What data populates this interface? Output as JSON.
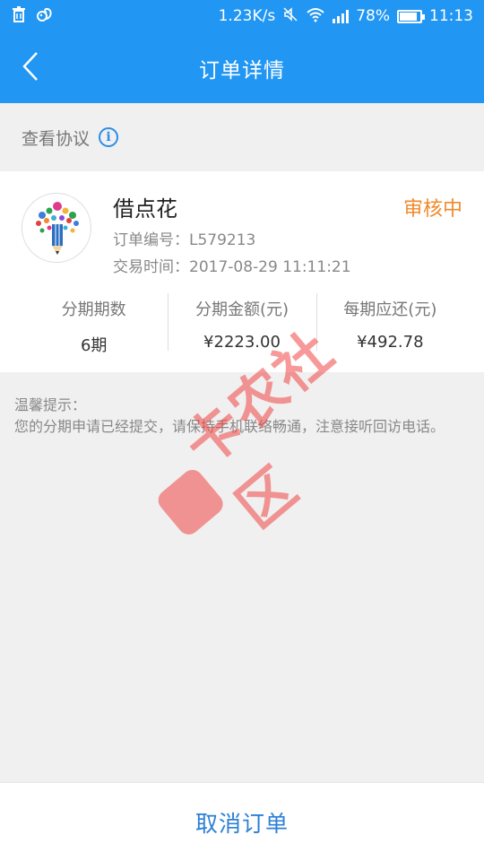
{
  "status_bar": {
    "speed": "1.23K/s",
    "battery": "78%",
    "battery_level": 0.78,
    "time": "11:13",
    "icons": [
      "trash-icon",
      "squirrel-icon",
      "mute-icon",
      "wifi-icon",
      "signal-icon",
      "battery-icon"
    ]
  },
  "nav": {
    "title": "订单详情",
    "back_icon": "chevron-left-icon"
  },
  "agreement": {
    "label": "查看协议",
    "icon": "info-icon",
    "icon_glyph": "i"
  },
  "order": {
    "product_name": "借点花",
    "status": "审核中",
    "order_no": "订单编号：L579213",
    "time": "交易时间：2017-08-29 11:11:21",
    "stats": [
      {
        "label": "分期期数",
        "value": "6期"
      },
      {
        "label": "分期金额(元)",
        "value": "¥2223.00"
      },
      {
        "label": "每期应还(元)",
        "value": "¥492.78"
      }
    ]
  },
  "notice": {
    "title": "温馨提示：",
    "body": "您的分期申请已经提交，请保持手机联络畅通，注意接听回访电话。"
  },
  "watermark": {
    "text": "卡农社区"
  },
  "actions": {
    "cancel_label": "取消订单"
  },
  "colors": {
    "primary": "#2196f3",
    "status_orange": "#f08a2b",
    "link_blue": "#2b7fd6"
  }
}
